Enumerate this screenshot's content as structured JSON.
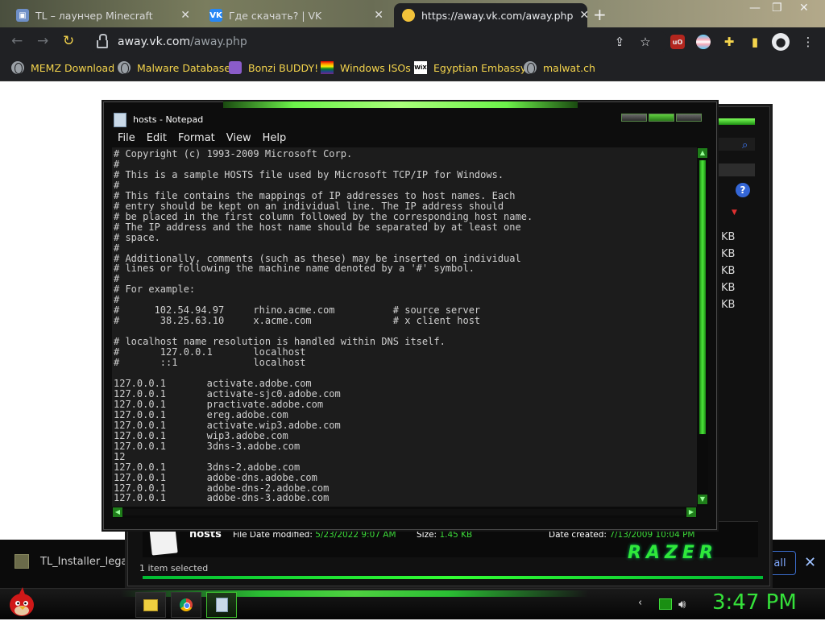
{
  "browser": {
    "tabs": [
      {
        "title": "TL – лаунчер Minecraft",
        "active": false
      },
      {
        "title": "Где скачать? | VK",
        "active": false
      },
      {
        "title": "https://away.vk.com/away.php",
        "active": true
      }
    ],
    "url_host": "away.vk.com",
    "url_path": "/away.php",
    "bookmarks": [
      {
        "label": "MEMZ Download",
        "icon": "globe-icon"
      },
      {
        "label": "Malware Database",
        "icon": "globe-icon"
      },
      {
        "label": "Bonzi BUDDY!",
        "icon": "bonzi-icon"
      },
      {
        "label": "Windows ISOs",
        "icon": "windows-icon"
      },
      {
        "label": "Egyptian Embassy",
        "icon": "wix-icon"
      },
      {
        "label": "malwat.ch",
        "icon": "globe-icon"
      }
    ],
    "download_file": "TL_Installer_legacy.e",
    "show_all_label": "all"
  },
  "notepad": {
    "title": "hosts - Notepad",
    "menu": [
      "File",
      "Edit",
      "Format",
      "View",
      "Help"
    ],
    "lines": [
      "# Copyright (c) 1993-2009 Microsoft Corp.",
      "#",
      "# This is a sample HOSTS file used by Microsoft TCP/IP for Windows.",
      "#",
      "# This file contains the mappings of IP addresses to host names. Each",
      "# entry should be kept on an individual line. The IP address should",
      "# be placed in the first column followed by the corresponding host name.",
      "# The IP address and the host name should be separated by at least one",
      "# space.",
      "#",
      "# Additionally, comments (such as these) may be inserted on individual",
      "# lines or following the machine name denoted by a '#' symbol.",
      "#",
      "# For example:",
      "#",
      "#      102.54.94.97     rhino.acme.com          # source server",
      "#       38.25.63.10     x.acme.com              # x client host",
      "",
      "# localhost name resolution is handled within DNS itself.",
      "#       127.0.0.1       localhost",
      "#       ::1             localhost",
      "",
      "127.0.0.1       activate.adobe.com",
      "127.0.0.1       activate-sjc0.adobe.com",
      "127.0.0.1       practivate.adobe.com",
      "127.0.0.1       ereg.adobe.com",
      "127.0.0.1       activate.wip3.adobe.com",
      "127.0.0.1       wip3.adobe.com",
      "127.0.0.1       3dns-3.adobe.com",
      "12",
      "127.0.0.1       3dns-2.adobe.com",
      "127.0.0.1       adobe-dns.adobe.com",
      "127.0.0.1       adobe-dns-2.adobe.com",
      "127.0.0.1       adobe-dns-3.adobe.com"
    ]
  },
  "explorer": {
    "file_name": "hosts",
    "date_modified_label": "File Date modified:",
    "date_modified": "5/23/2022 9:07 AM",
    "size_label": "Size:",
    "size": "1.45 KB",
    "date_created_label": "Date created:",
    "date_created": "7/13/2009 10:04 PM",
    "brand": "RAZER",
    "status": "1 item selected",
    "kb_labels": [
      "KB",
      "KB",
      "KB",
      "KB",
      "KB"
    ]
  },
  "taskbar": {
    "clock": "3:47 PM"
  },
  "colors": {
    "accent_green": "#35e13a",
    "bookmark_text": "#f4d44c"
  }
}
